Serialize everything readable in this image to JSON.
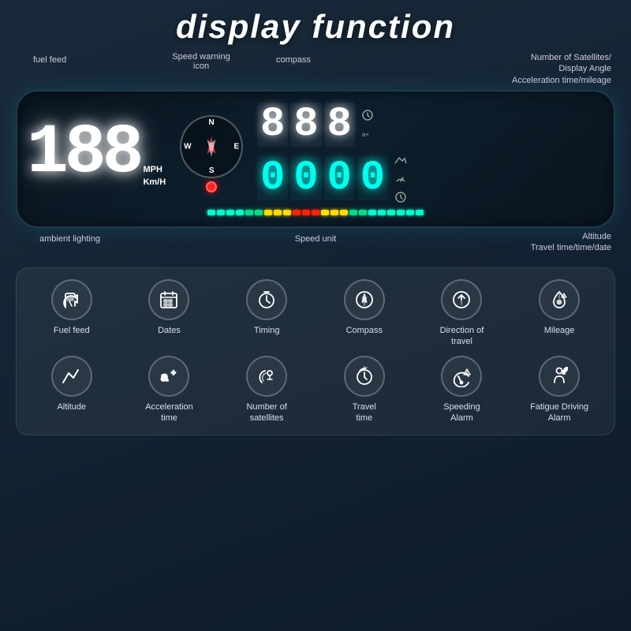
{
  "title": "display function",
  "hud": {
    "speed": "188",
    "unit_mph": "MPH",
    "unit_kmh": "Km/H",
    "compass_labels": [
      "N",
      "E",
      "S",
      "W"
    ],
    "display_top": [
      "8",
      "8",
      "8"
    ],
    "display_bottom": [
      "0",
      "0",
      "0",
      "0"
    ],
    "led_colors": [
      "cyan",
      "cyan",
      "cyan",
      "cyan",
      "green",
      "green",
      "green",
      "green",
      "yellow",
      "yellow",
      "red",
      "red",
      "red",
      "yellow",
      "yellow",
      "green",
      "green",
      "green",
      "cyan",
      "cyan",
      "cyan",
      "cyan",
      "cyan"
    ]
  },
  "annotations": {
    "top": {
      "fuel_feed": "fuel feed",
      "speed_warning": "Speed warning\nicon",
      "compass": "compass",
      "satellites": "Number of Satellites/\nDisplay Angle\nAcceleration time/mileage"
    },
    "bottom": {
      "ambient": "ambient lighting",
      "speed_unit": "Speed unit",
      "altitude": "Altitude\nTravel time/time/date"
    }
  },
  "features": [
    {
      "icon": "fuel",
      "label": "Fuel feed"
    },
    {
      "icon": "dates",
      "label": "Dates"
    },
    {
      "icon": "timing",
      "label": "Timing"
    },
    {
      "icon": "compass",
      "label": "Compass"
    },
    {
      "icon": "direction",
      "label": "Direction of\ntravel"
    },
    {
      "icon": "mileage",
      "label": "Mileage"
    },
    {
      "icon": "altitude",
      "label": "Altitude"
    },
    {
      "icon": "acceleration",
      "label": "Acceleration\ntime"
    },
    {
      "icon": "satellites",
      "label": "Number of\nsatellites"
    },
    {
      "icon": "travel",
      "label": "Travel\ntime"
    },
    {
      "icon": "speeding",
      "label": "Speeding\nAlarm"
    },
    {
      "icon": "fatigue",
      "label": "Fatigue Driving\nAlarm"
    }
  ]
}
